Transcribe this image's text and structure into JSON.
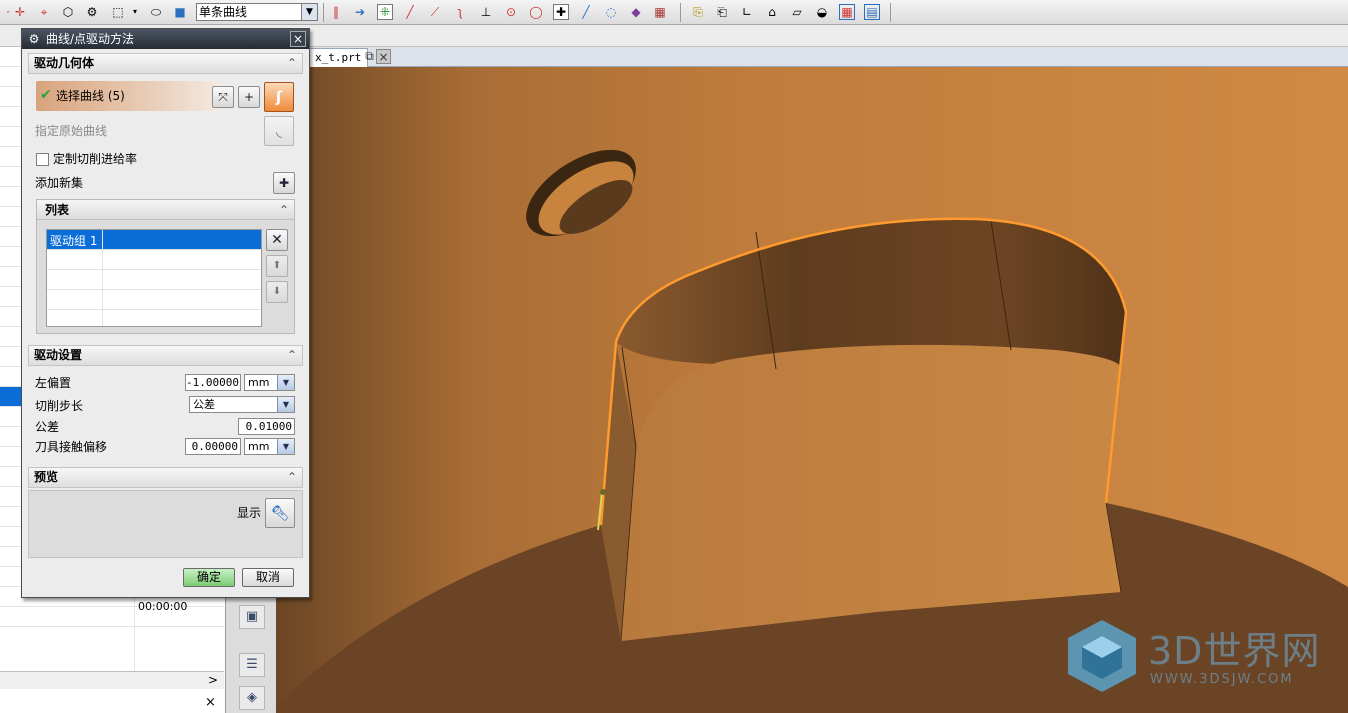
{
  "toolbar": {
    "filter_value": "单条曲线",
    "icons": [
      "snap-icon",
      "point-icon",
      "face-icon",
      "body-icon",
      "box-select-icon",
      "view-icon",
      "cube-icon",
      "line-icon",
      "arrow-icon",
      "grid-icon",
      "curve-icon",
      "tangent-icon",
      "circle-icon",
      "center-icon",
      "cross-icon",
      "plus-icon",
      "pen-icon",
      "layer-icon",
      "sketch-icon",
      "doc-icon",
      "plane-icon",
      "table-icon"
    ]
  },
  "left_panel": {
    "time_value": "00:00:00",
    "scroll_arrow": ">",
    "bottom_close": "×"
  },
  "viewport": {
    "tab_label": "x_t.prt",
    "tab_close": "⧉",
    "close_symbol": "×"
  },
  "dialog": {
    "title": "曲线/点驱动方法",
    "close": "×",
    "section_geometry": "驱动几何体",
    "select_curve": "选择曲线 (5)",
    "specify_original_curve": "指定原始曲线",
    "custom_feed": "定制切削进给率",
    "add_new_set": "添加新集",
    "list_title": "列表",
    "list_items": [
      "驱动组 1"
    ],
    "section_settings": "驱动设置",
    "left_offset_label": "左偏置",
    "left_offset_value": "-1.00000",
    "left_offset_unit": "mm",
    "step_label": "切削步长",
    "step_value": "公差",
    "tolerance_label": "公差",
    "tolerance_value": "0.01000",
    "contact_offset_label": "刀具接触偏移",
    "contact_offset_value": "0.00000",
    "contact_offset_unit": "mm",
    "section_preview": "预览",
    "show_label": "显示",
    "ok": "确定",
    "cancel": "取消",
    "caret_up": "⌃"
  },
  "watermark": {
    "brand": "3D世界网",
    "url": "WWW.3DSJW.COM"
  },
  "colors": {
    "model_orange": "#c88642",
    "model_dark": "#6a4425",
    "highlight": "#ff9a2e",
    "selection_blue": "#0b6ed8"
  }
}
